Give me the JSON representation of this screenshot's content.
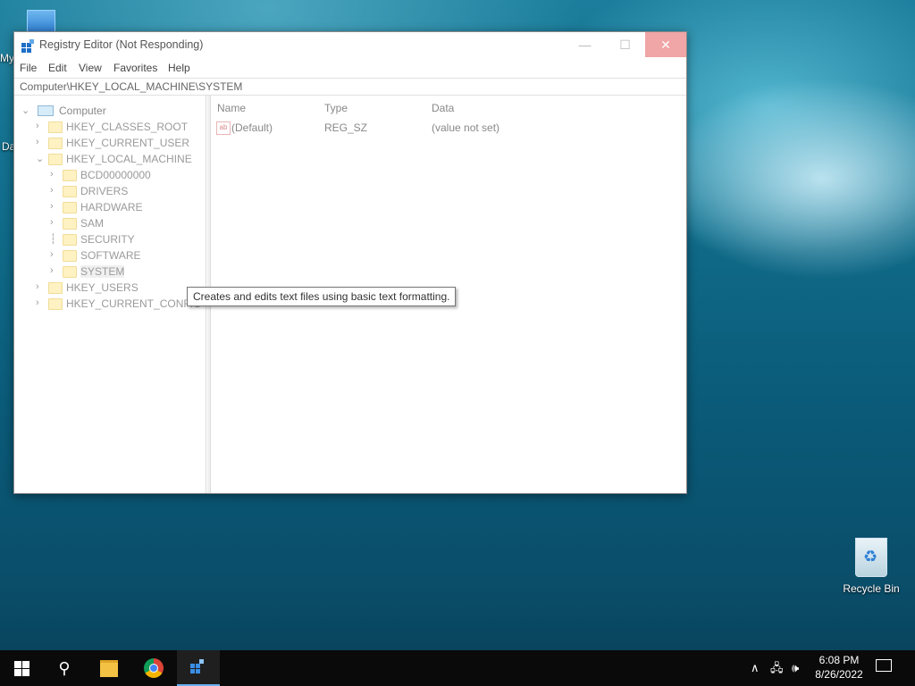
{
  "desktop": {
    "icons": [
      {
        "label": "My"
      },
      {
        "label": "Da"
      },
      {
        "label": "Recycle Bin"
      }
    ]
  },
  "window": {
    "title": "Registry Editor (Not Responding)",
    "controls": {
      "minimize": "—",
      "maximize": "☐",
      "close": "✕"
    },
    "menu": [
      "File",
      "Edit",
      "View",
      "Favorites",
      "Help"
    ],
    "address": "Computer\\HKEY_LOCAL_MACHINE\\SYSTEM",
    "tree": {
      "root": "Computer",
      "hives": [
        {
          "label": "HKEY_CLASSES_ROOT",
          "expanded": false
        },
        {
          "label": "HKEY_CURRENT_USER",
          "expanded": false
        },
        {
          "label": "HKEY_LOCAL_MACHINE",
          "expanded": true,
          "children": [
            "BCD00000000",
            "DRIVERS",
            "HARDWARE",
            "SAM",
            "SECURITY",
            "SOFTWARE",
            "SYSTEM"
          ]
        },
        {
          "label": "HKEY_USERS",
          "expanded": false
        },
        {
          "label": "HKEY_CURRENT_CONFIG",
          "expanded": false
        }
      ],
      "selected": "SYSTEM"
    },
    "list": {
      "columns": [
        "Name",
        "Type",
        "Data"
      ],
      "rows": [
        {
          "icon": "string-value-icon",
          "icon_text": "ab",
          "name": "(Default)",
          "type": "REG_SZ",
          "data": "(value not set)"
        }
      ]
    }
  },
  "tooltip": "Creates and edits text files using basic text formatting.",
  "taskbar": {
    "apps": [
      "start-icon",
      "search-icon",
      "file-explorer-icon",
      "chrome-icon",
      "regedit-icon"
    ],
    "clock": {
      "time": "6:08 PM",
      "date": "8/26/2022"
    },
    "tray": {
      "chevron": "∧",
      "network": "🖧",
      "volume": "🕪"
    }
  },
  "colors": {
    "accent": "#0078d7",
    "close_hover": "#f0a5a6"
  }
}
